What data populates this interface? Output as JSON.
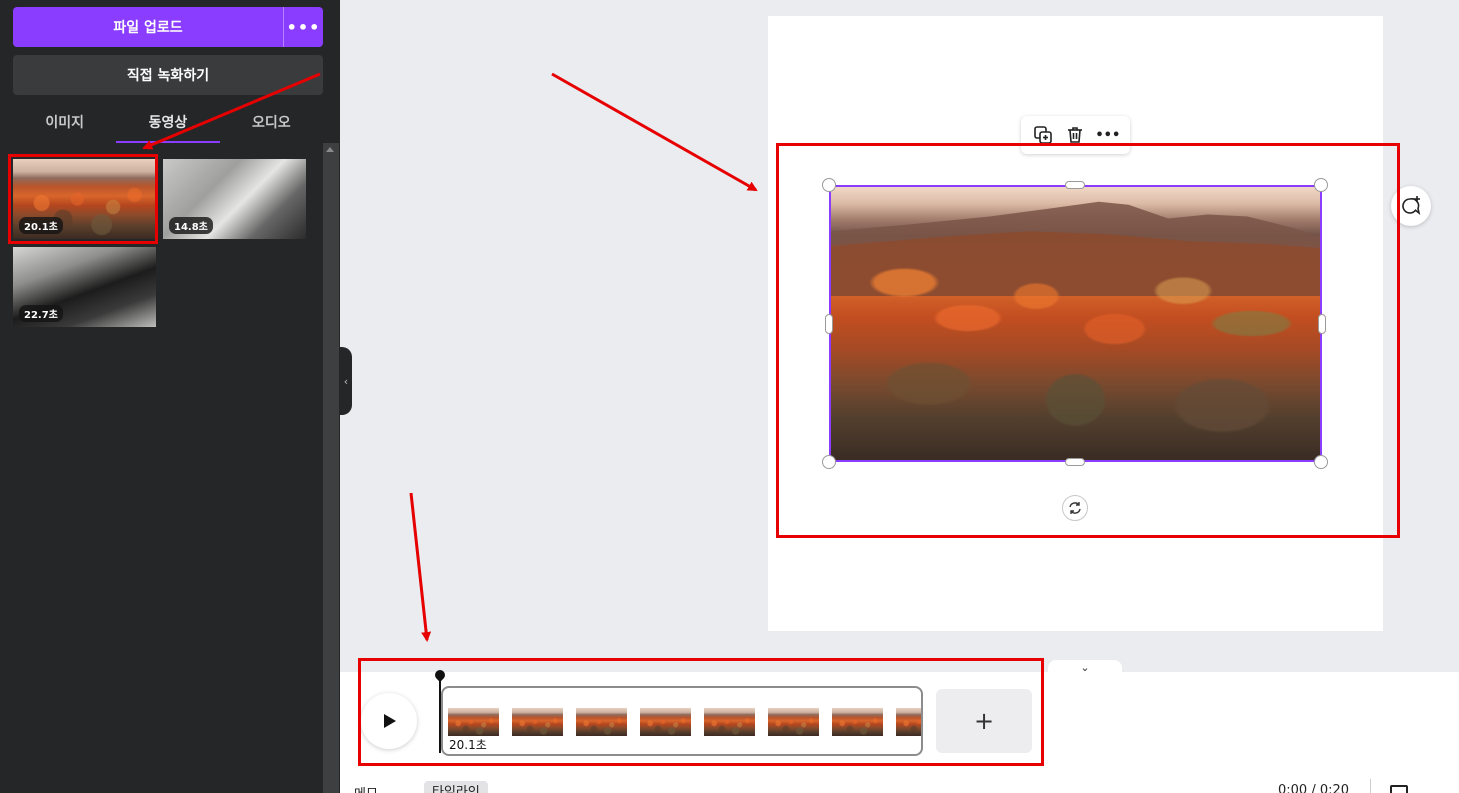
{
  "sidebar": {
    "upload_label": "파일 업로드",
    "more_label": "•••",
    "record_label": "직접 녹화하기",
    "tabs": [
      {
        "label": "이미지",
        "active": false
      },
      {
        "label": "동영상",
        "active": true
      },
      {
        "label": "오디오",
        "active": false
      }
    ],
    "videos": [
      {
        "duration": "20.1초"
      },
      {
        "duration": "14.8초"
      },
      {
        "duration": "22.7초"
      }
    ]
  },
  "canvas": {
    "toolbar_icons": [
      "duplicate-icon",
      "trash-icon",
      "more-icon"
    ],
    "more_label": "•••"
  },
  "timeline": {
    "clip_duration": "20.1초",
    "add_label": "+",
    "collapse_label": "⌄",
    "frame_count": 8
  },
  "bottom_bar": {
    "notes_label": "메모",
    "timeline_label": "타임라인",
    "time_label": "0:00 / 0:20"
  },
  "colors": {
    "accent": "#8b3dff",
    "sidebar_bg": "#252627",
    "annotation_red": "#e60000"
  }
}
